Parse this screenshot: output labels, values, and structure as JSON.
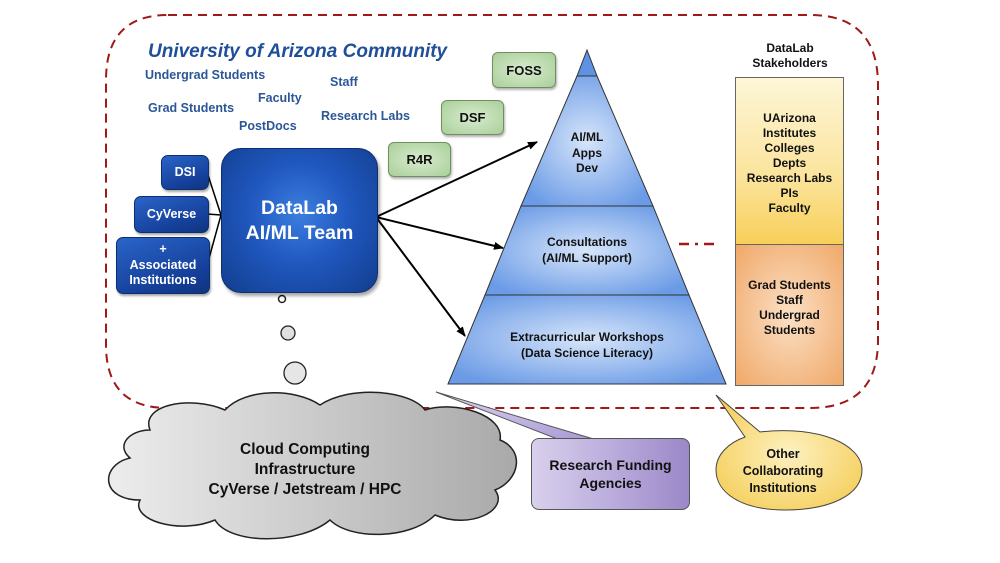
{
  "community": {
    "title": "University of Arizona Community",
    "members": [
      "Undergrad Students",
      "Staff",
      "Faculty",
      "Grad Students",
      "Research Labs",
      "PostDocs"
    ]
  },
  "partners": [
    {
      "label": "DSI"
    },
    {
      "label": "CyVerse"
    },
    {
      "label_lines": [
        "+",
        "Associated",
        "Institutions"
      ]
    }
  ],
  "team": {
    "line1": "DataLab",
    "line2": "AI/ML Team"
  },
  "programs": [
    "FOSS",
    "DSF",
    "R4R"
  ],
  "pyramid": {
    "top": [
      "AI/ML",
      "Apps",
      "Dev"
    ],
    "middle": [
      "Consultations",
      "(AI/ML Support)"
    ],
    "bottom": [
      "Extracurricular Workshops",
      "(Data Science Literacy)"
    ]
  },
  "stakeholders": {
    "title": [
      "DataLab",
      "Stakeholders"
    ],
    "upper": [
      "UArizona",
      "Institutes",
      "Colleges",
      "Depts",
      "Research Labs",
      "PIs",
      "Faculty"
    ],
    "lower": [
      "Grad Students",
      "Staff",
      "Undergrad",
      "Students"
    ]
  },
  "cloud": {
    "lines": [
      "Cloud Computing",
      "Infrastructure",
      "CyVerse / Jetstream / HPC"
    ]
  },
  "funding": {
    "lines": [
      "Research Funding",
      "Agencies"
    ]
  },
  "collaborators": {
    "lines": [
      "Other",
      "Collaborating",
      "Institutions"
    ]
  },
  "colors": {
    "boundary_dash": "#a01818",
    "team_blue": "#1e56bd",
    "community_text": "#2b5797",
    "pyramid_blue": "#6e9ee8",
    "program_green": "#a9cf98",
    "stake_yellow": "#f8d25e",
    "stake_orange": "#f0a868",
    "funding_purple": "#a898d4",
    "collab_yellow": "#f7d46a",
    "cloud_gray": "#c8c8c8"
  }
}
